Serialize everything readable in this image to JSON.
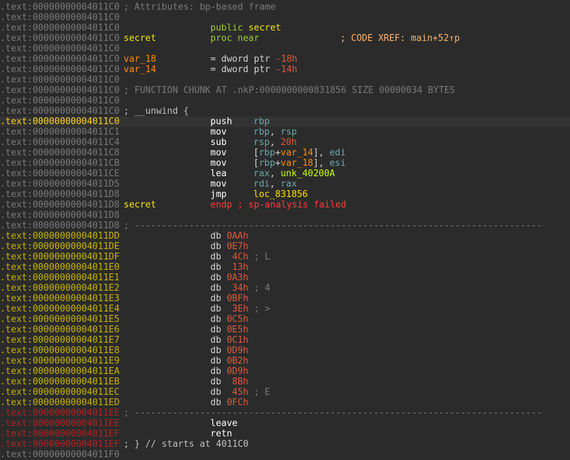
{
  "colors": {
    "background": "#2b2b2b",
    "address_gray": "#7a7a7a",
    "address_yellow": "#c8b400",
    "address_red": "#b22222",
    "register": "#6aaaaa",
    "number": "#e05a3a",
    "error": "#ff3b3b"
  },
  "lines": [
    {
      "addr": ".text:00000000004011C0",
      "addr_class": "a-gray",
      "comment": "; Attributes: bp-based frame",
      "comment_class": "cmt"
    },
    {
      "addr": ".text:00000000004011C0",
      "addr_class": "a-gray"
    },
    {
      "addr": ".text:00000000004011C0",
      "addr_class": "a-gray",
      "ins": [
        {
          "t": "public ",
          "c": "kw-green"
        },
        {
          "t": "secret",
          "c": "name-y"
        }
      ]
    },
    {
      "addr": ".text:00000000004011C0",
      "addr_class": "a-gray",
      "label": "secret",
      "label_class": "name-y",
      "ins": [
        {
          "t": "proc near",
          "c": "kw-green"
        }
      ],
      "xref": "; CODE XREF: main+52↑p"
    },
    {
      "addr": ".text:00000000004011C0",
      "addr_class": "a-gray"
    },
    {
      "addr": ".text:00000000004011C0",
      "addr_class": "a-gray",
      "label": "var_18",
      "label_class": "var",
      "ins": [
        {
          "t": "= dword ptr ",
          "c": "plain"
        },
        {
          "t": "-18h",
          "c": "num"
        }
      ]
    },
    {
      "addr": ".text:00000000004011C0",
      "addr_class": "a-gray",
      "label": "var_14",
      "label_class": "var",
      "ins": [
        {
          "t": "= dword ptr ",
          "c": "plain"
        },
        {
          "t": "-14h",
          "c": "num"
        }
      ]
    },
    {
      "addr": ".text:00000000004011C0",
      "addr_class": "a-gray"
    },
    {
      "addr": ".text:00000000004011C0",
      "addr_class": "a-gray",
      "comment": "; FUNCTION CHUNK AT .nkP:0000000000831856 SIZE 00000034 BYTES",
      "comment_class": "cmt"
    },
    {
      "addr": ".text:00000000004011C0",
      "addr_class": "a-gray"
    },
    {
      "addr": ".text:00000000004011C0",
      "addr_class": "a-gray",
      "comment": "; __unwind {",
      "comment_class": "cmt-lt"
    },
    {
      "addr": ".text:00000000004011C0",
      "addr_class": "a-cur",
      "current": true,
      "ins": [
        {
          "t": "push",
          "c": "mnem"
        }
      ],
      "ops": [
        {
          "t": "rbp",
          "c": "reg"
        }
      ]
    },
    {
      "addr": ".text:00000000004011C1",
      "addr_class": "a-gray",
      "ins": [
        {
          "t": "mov",
          "c": "mnem"
        }
      ],
      "ops": [
        {
          "t": "rbp",
          "c": "reg"
        },
        {
          "t": ", ",
          "c": "plain"
        },
        {
          "t": "rsp",
          "c": "reg"
        }
      ]
    },
    {
      "addr": ".text:00000000004011C4",
      "addr_class": "a-gray",
      "ins": [
        {
          "t": "sub",
          "c": "mnem"
        }
      ],
      "ops": [
        {
          "t": "rsp",
          "c": "reg"
        },
        {
          "t": ", ",
          "c": "plain"
        },
        {
          "t": "20h",
          "c": "num"
        }
      ]
    },
    {
      "addr": ".text:00000000004011C8",
      "addr_class": "a-gray",
      "ins": [
        {
          "t": "mov",
          "c": "mnem"
        }
      ],
      "ops": [
        {
          "t": "[",
          "c": "plain"
        },
        {
          "t": "rbp",
          "c": "reg"
        },
        {
          "t": "+",
          "c": "plain"
        },
        {
          "t": "var_14",
          "c": "var"
        },
        {
          "t": "], ",
          "c": "plain"
        },
        {
          "t": "edi",
          "c": "reg"
        }
      ]
    },
    {
      "addr": ".text:00000000004011CB",
      "addr_class": "a-gray",
      "ins": [
        {
          "t": "mov",
          "c": "mnem"
        }
      ],
      "ops": [
        {
          "t": "[",
          "c": "plain"
        },
        {
          "t": "rbp",
          "c": "reg"
        },
        {
          "t": "+",
          "c": "plain"
        },
        {
          "t": "var_18",
          "c": "var"
        },
        {
          "t": "], ",
          "c": "plain"
        },
        {
          "t": "esi",
          "c": "reg"
        }
      ]
    },
    {
      "addr": ".text:00000000004011CE",
      "addr_class": "a-gray",
      "ins": [
        {
          "t": "lea",
          "c": "mnem"
        }
      ],
      "ops": [
        {
          "t": "rax",
          "c": "reg"
        },
        {
          "t": ", ",
          "c": "plain"
        },
        {
          "t": "unk_40200A",
          "c": "lime"
        }
      ]
    },
    {
      "addr": ".text:00000000004011D5",
      "addr_class": "a-gray",
      "ins": [
        {
          "t": "mov",
          "c": "mnem"
        }
      ],
      "ops": [
        {
          "t": "rdi",
          "c": "reg"
        },
        {
          "t": ", ",
          "c": "plain"
        },
        {
          "t": "rax",
          "c": "reg"
        }
      ]
    },
    {
      "addr": ".text:00000000004011D8",
      "addr_class": "a-gray",
      "ins": [
        {
          "t": "jmp",
          "c": "mnem"
        }
      ],
      "ops": [
        {
          "t": "loc_831856",
          "c": "loc"
        }
      ]
    },
    {
      "addr": ".text:00000000004011D8",
      "addr_class": "a-gray",
      "label": "secret",
      "label_class": "name-y",
      "ins": [
        {
          "t": "endp ; sp-analysis failed",
          "c": "err"
        }
      ]
    },
    {
      "addr": ".text:00000000004011D8",
      "addr_class": "a-gray"
    },
    {
      "addr": ".text:00000000004011D8",
      "addr_class": "a-gray",
      "separator": "; ---------------------------------------------------------------------------"
    },
    {
      "addr": ".text:00000000004011DD",
      "addr_class": "a-yellow",
      "ins": [
        {
          "t": "db ",
          "c": "plain"
        },
        {
          "t": "0AAh",
          "c": "num"
        }
      ]
    },
    {
      "addr": ".text:00000000004011DE",
      "addr_class": "a-yellow",
      "ins": [
        {
          "t": "db ",
          "c": "plain"
        },
        {
          "t": "0E7h",
          "c": "num"
        }
      ]
    },
    {
      "addr": ".text:00000000004011DF",
      "addr_class": "a-yellow",
      "ins": [
        {
          "t": "db  ",
          "c": "plain"
        },
        {
          "t": "4Ch",
          "c": "num"
        },
        {
          "t": " ; L",
          "c": "cmt"
        }
      ]
    },
    {
      "addr": ".text:00000000004011E0",
      "addr_class": "a-yellow",
      "ins": [
        {
          "t": "db  ",
          "c": "plain"
        },
        {
          "t": "13h",
          "c": "num"
        }
      ]
    },
    {
      "addr": ".text:00000000004011E1",
      "addr_class": "a-yellow",
      "ins": [
        {
          "t": "db ",
          "c": "plain"
        },
        {
          "t": "0A3h",
          "c": "num"
        }
      ]
    },
    {
      "addr": ".text:00000000004011E2",
      "addr_class": "a-yellow",
      "ins": [
        {
          "t": "db  ",
          "c": "plain"
        },
        {
          "t": "34h",
          "c": "num"
        },
        {
          "t": " ; 4",
          "c": "cmt"
        }
      ]
    },
    {
      "addr": ".text:00000000004011E3",
      "addr_class": "a-yellow",
      "ins": [
        {
          "t": "db ",
          "c": "plain"
        },
        {
          "t": "0BFh",
          "c": "num"
        }
      ]
    },
    {
      "addr": ".text:00000000004011E4",
      "addr_class": "a-yellow",
      "ins": [
        {
          "t": "db  ",
          "c": "plain"
        },
        {
          "t": "3Eh",
          "c": "num"
        },
        {
          "t": " ; >",
          "c": "cmt"
        }
      ]
    },
    {
      "addr": ".text:00000000004011E5",
      "addr_class": "a-yellow",
      "ins": [
        {
          "t": "db ",
          "c": "plain"
        },
        {
          "t": "0C5h",
          "c": "num"
        }
      ]
    },
    {
      "addr": ".text:00000000004011E6",
      "addr_class": "a-yellow",
      "ins": [
        {
          "t": "db ",
          "c": "plain"
        },
        {
          "t": "0E5h",
          "c": "num"
        }
      ]
    },
    {
      "addr": ".text:00000000004011E7",
      "addr_class": "a-yellow",
      "ins": [
        {
          "t": "db ",
          "c": "plain"
        },
        {
          "t": "0C1h",
          "c": "num"
        }
      ]
    },
    {
      "addr": ".text:00000000004011E8",
      "addr_class": "a-yellow",
      "ins": [
        {
          "t": "db ",
          "c": "plain"
        },
        {
          "t": "0D9h",
          "c": "num"
        }
      ]
    },
    {
      "addr": ".text:00000000004011E9",
      "addr_class": "a-yellow",
      "ins": [
        {
          "t": "db ",
          "c": "plain"
        },
        {
          "t": "0B2h",
          "c": "num"
        }
      ]
    },
    {
      "addr": ".text:00000000004011EA",
      "addr_class": "a-yellow",
      "ins": [
        {
          "t": "db ",
          "c": "plain"
        },
        {
          "t": "0D9h",
          "c": "num"
        }
      ]
    },
    {
      "addr": ".text:00000000004011EB",
      "addr_class": "a-yellow",
      "ins": [
        {
          "t": "db  ",
          "c": "plain"
        },
        {
          "t": "8Bh",
          "c": "num"
        }
      ]
    },
    {
      "addr": ".text:00000000004011EC",
      "addr_class": "a-yellow",
      "ins": [
        {
          "t": "db  ",
          "c": "plain"
        },
        {
          "t": "45h",
          "c": "num"
        },
        {
          "t": " ; E",
          "c": "cmt"
        }
      ]
    },
    {
      "addr": ".text:00000000004011ED",
      "addr_class": "a-yellow",
      "ins": [
        {
          "t": "db ",
          "c": "plain"
        },
        {
          "t": "0FCh",
          "c": "num"
        }
      ]
    },
    {
      "addr": ".text:00000000004011EE",
      "addr_class": "a-red",
      "separator": "; ---------------------------------------------------------------------------"
    },
    {
      "addr": ".text:00000000004011EE",
      "addr_class": "a-red",
      "ins": [
        {
          "t": "leave",
          "c": "mnem"
        }
      ]
    },
    {
      "addr": ".text:00000000004011EF",
      "addr_class": "a-red",
      "ins": [
        {
          "t": "retn",
          "c": "mnem"
        }
      ]
    },
    {
      "addr": ".text:00000000004011EF",
      "addr_class": "a-red",
      "comment": "; } // starts at 4011C0",
      "comment_class": "cmt-lt"
    },
    {
      "addr": ".text:00000000004011F0",
      "addr_class": "a-gray"
    }
  ]
}
